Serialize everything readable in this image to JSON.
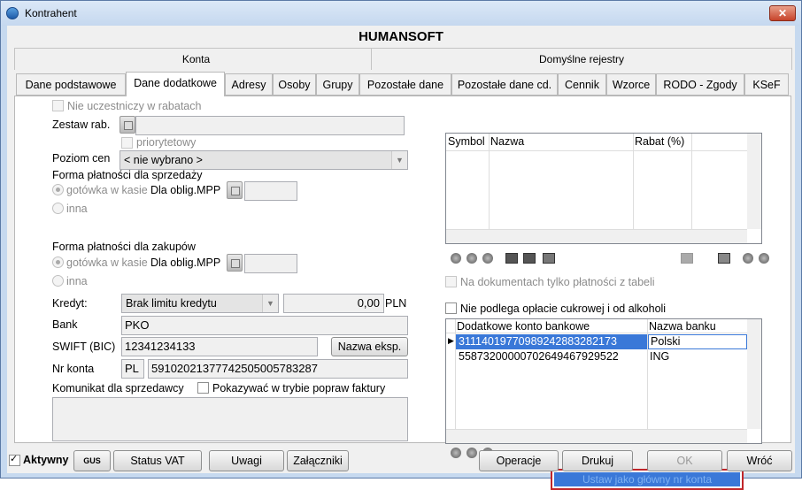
{
  "window": {
    "title": "Kontrahent",
    "close_label": "✕"
  },
  "header": {
    "company": "HUMANSOFT"
  },
  "section_tabs": {
    "left": "Konta",
    "right": "Domyślne rejestry"
  },
  "tabs": [
    {
      "label": "Dane podstawowe"
    },
    {
      "label": "Dane dodatkowe"
    },
    {
      "label": "Adresy"
    },
    {
      "label": "Osoby"
    },
    {
      "label": "Grupy"
    },
    {
      "label": "Pozostałe dane"
    },
    {
      "label": "Pozostałe dane cd."
    },
    {
      "label": "Cennik"
    },
    {
      "label": "Wzorce"
    },
    {
      "label": "RODO - Zgody"
    },
    {
      "label": "KSeF"
    }
  ],
  "active_tab": "Dane dodatkowe",
  "left": {
    "nie_uczestniczy": "Nie uczestniczy w rabatach",
    "zestaw_rab_label": "Zestaw rab.",
    "zestaw_rab_value": "",
    "priorytetowy": "priorytetowy",
    "poziom_cen_label": "Poziom cen",
    "poziom_cen_value": "< nie wybrano >",
    "sprzedaz_label": "Forma płatności dla sprzedaży",
    "gotowka": "gotówka w kasie",
    "dla_oblig": "Dla oblig.MPP",
    "inna": "inna",
    "zakupy_label": "Forma płatności dla zakupów",
    "kredyt_label": "Kredyt:",
    "kredyt_value": "Brak limitu kredytu",
    "kwota": "0,00",
    "waluta": "PLN",
    "bank_label": "Bank",
    "bank_value": "PKO",
    "swift_label": "SWIFT (BIC)",
    "swift_value": "12341234133",
    "nazwa_eksp": "Nazwa eksp.",
    "nr_konta_label": "Nr konta",
    "kraj": "PL",
    "nr_konta_value": "59102021377742505005783287",
    "komunikat_label": "Komunikat dla sprzedawcy",
    "pokazywac": "Pokazywać w trybie popraw faktury"
  },
  "rabat_grid": {
    "columns": [
      "Symbol",
      "Nazwa",
      "Rabat (%)"
    ],
    "rows": []
  },
  "right": {
    "na_dokumentach": "Na dokumentach tylko płatności z tabeli",
    "nie_podlega": "Nie podlega opłacie cukrowej i od alkoholi"
  },
  "konta_grid": {
    "columns": [
      "Dodatkowe konto bankowe",
      "Nazwa banku"
    ],
    "rows": [
      {
        "konto": "31114019770989242883282173",
        "bank": "Polski"
      },
      {
        "konto": "55873200000702649467929522",
        "bank": "ING"
      }
    ]
  },
  "context_menu": {
    "item": "Ustaw jako główny nr konta"
  },
  "footer": {
    "aktywny": "Aktywny",
    "gus": "GUS",
    "status_vat": "Status VAT",
    "uwagi": "Uwagi",
    "zalaczniki": "Załączniki",
    "operacje": "Operacje",
    "drukuj": "Drukuj",
    "ok": "OK",
    "wroc": "Wróć"
  },
  "colors": {
    "accent": "#3a78d8",
    "selection": "#3a78d8",
    "highlight_border": "#c0262a"
  }
}
